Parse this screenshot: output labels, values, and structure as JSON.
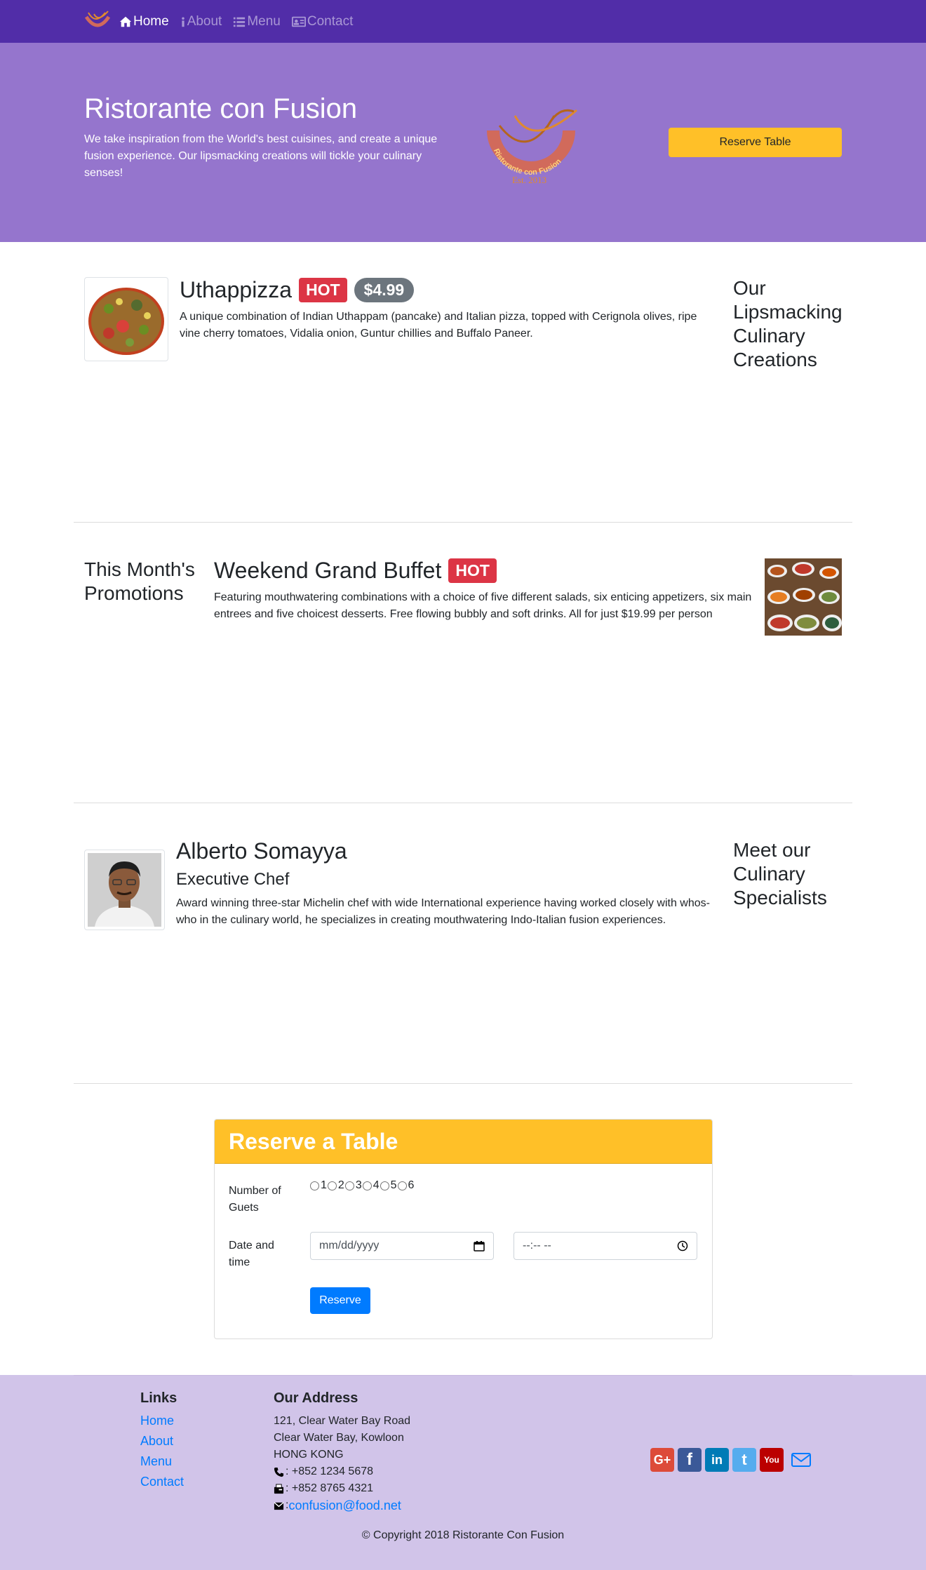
{
  "nav": {
    "items": [
      {
        "label": "Home",
        "icon": "home-icon"
      },
      {
        "label": "About",
        "icon": "info-icon"
      },
      {
        "label": "Menu",
        "icon": "list-icon"
      },
      {
        "label": "Contact",
        "icon": "address-card-icon"
      }
    ]
  },
  "jumbotron": {
    "title": "Ristorante con Fusion",
    "text": "We take inspiration from the World's best cuisines, and create a unique fusion experience. Our lipsmacking creations will tickle your culinary senses!",
    "logo_text": "Ristorante con Fusion",
    "logo_est": "Est. 2013",
    "button": "Reserve Table"
  },
  "dish": {
    "name": "Uthappizza",
    "badge": "HOT",
    "price": "$4.99",
    "description": "A unique combination of Indian Uthappam (pancake) and Italian pizza, topped with Cerignola olives, ripe vine cherry tomatoes, Vidalia onion, Guntur chillies and Buffalo Paneer.",
    "side_heading": "Our Lipsmacking Culinary Creations"
  },
  "promotion": {
    "side_heading": "This Month's Promotions",
    "name": "Weekend Grand Buffet",
    "badge": "HOT",
    "description": "Featuring mouthwatering combinations with a choice of five different salads, six enticing appetizers, six main entrees and five choicest desserts. Free flowing bubbly and soft drinks. All for just $19.99 per person"
  },
  "leader": {
    "name": "Alberto Somayya",
    "designation": "Executive Chef",
    "description": "Award winning three-star Michelin chef with wide International experience having worked closely with whos-who in the culinary world, he specializes in creating mouthwatering Indo-Italian fusion experiences.",
    "side_heading": "Meet our Culinary Specialists"
  },
  "reserve": {
    "title": "Reserve a Table",
    "guests_label": "Number of Guets",
    "guest_options": [
      "1",
      "2",
      "3",
      "4",
      "5",
      "6"
    ],
    "datetime_label": "Date and time",
    "date_placeholder": "mm/dd/yyyy",
    "time_placeholder": "--:-- --",
    "button": "Reserve"
  },
  "footer": {
    "links_heading": "Links",
    "links": [
      "Home",
      "About",
      "Menu",
      "Contact"
    ],
    "address_heading": "Our Address",
    "address_lines": [
      "121, Clear Water Bay Road",
      "Clear Water Bay, Kowloon",
      "HONG KONG"
    ],
    "phone": ": +852 1234 5678",
    "fax": ": +852 8765 4321",
    "email_prefix": ": ",
    "email": "confusion@food.net",
    "social": [
      {
        "name": "google-plus-icon",
        "glyph": "G+",
        "color": "#dd4b39"
      },
      {
        "name": "facebook-icon",
        "glyph": "f",
        "color": "#3b5998"
      },
      {
        "name": "linkedin-icon",
        "glyph": "in",
        "color": "#007bb6"
      },
      {
        "name": "twitter-icon",
        "glyph": "t",
        "color": "#55acee"
      },
      {
        "name": "youtube-icon",
        "glyph": "You",
        "color": "#bb0000"
      }
    ],
    "copyright": "© Copyright 2018 Ristorante Con Fusion"
  },
  "colors": {
    "nav_bg": "#512da8",
    "jumbo_bg": "#9575cd",
    "accent": "#ffc028",
    "footer_bg": "#d1c4e9",
    "link": "#007bff"
  }
}
